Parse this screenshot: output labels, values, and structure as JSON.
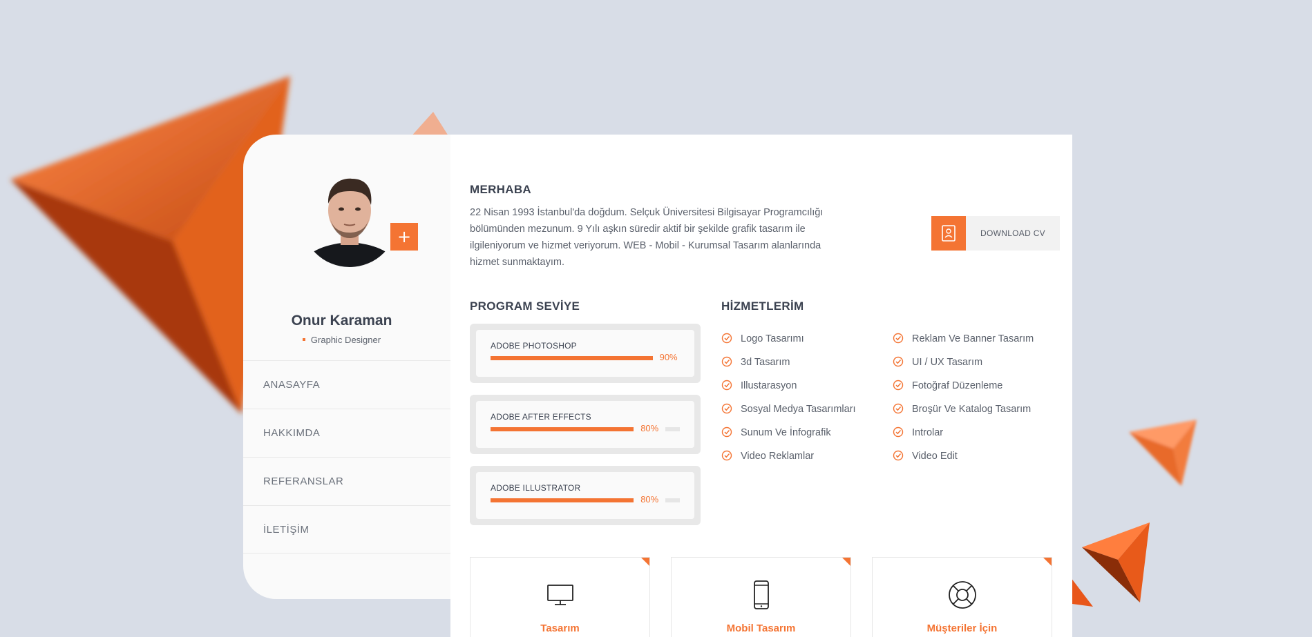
{
  "profile": {
    "name": "Onur Karaman",
    "role": "Graphic Designer",
    "add_label": "+"
  },
  "nav": {
    "items": [
      {
        "label": "ANASAYFA"
      },
      {
        "label": "HAKKIMDA"
      },
      {
        "label": "REFERANSLAR"
      },
      {
        "label": "İLETİŞİM"
      }
    ]
  },
  "about": {
    "title": "MERHABA",
    "text": "22 Nisan 1993 İstanbul'da doğdum. Selçuk Üniversitesi Bilgisayar Programcılığı bölümünden mezunum. 9 Yılı aşkın süredir aktif bir şekilde grafik tasarım ile ilgileniyorum ve hizmet veriyorum. WEB - Mobil - Kurumsal Tasarım alanlarında hizmet sunmaktayım.",
    "download_label": "DOWNLOAD CV",
    "download_icon": "cv-document-icon"
  },
  "skills": {
    "title": "PROGRAM SEVİYE",
    "items": [
      {
        "name": "ADOBE PHOTOSHOP",
        "percent_label": "90%",
        "level": 0.9
      },
      {
        "name": "ADOBE AFTER EFFECTS",
        "percent_label": "80%",
        "level": 0.8
      },
      {
        "name": "ADOBE ILLUSTRATOR",
        "percent_label": "80%",
        "level": 0.8
      }
    ]
  },
  "services": {
    "title": "HİZMETLERİM",
    "col1": [
      "Logo Tasarımı",
      "3d Tasarım",
      "Illustarasyon",
      "Sosyal Medya Tasarımları",
      "Sunum Ve İnfografik",
      "Video Reklamlar"
    ],
    "col2": [
      "Reklam Ve Banner Tasarım",
      "UI / UX Tasarım",
      "Fotoğraf Düzenleme",
      "Broşür Ve Katalog Tasarım",
      "Introlar",
      "Video Edit"
    ]
  },
  "features": [
    {
      "label": "Tasarım",
      "icon": "monitor-icon"
    },
    {
      "label": "Mobil Tasarım",
      "icon": "smartphone-icon"
    },
    {
      "label": "Müşteriler İçin",
      "icon": "lifebuoy-icon"
    }
  ],
  "colors": {
    "accent": "#f47433",
    "background": "#d8dde7",
    "card": "#ffffff",
    "sidebar": "#fafafa"
  }
}
